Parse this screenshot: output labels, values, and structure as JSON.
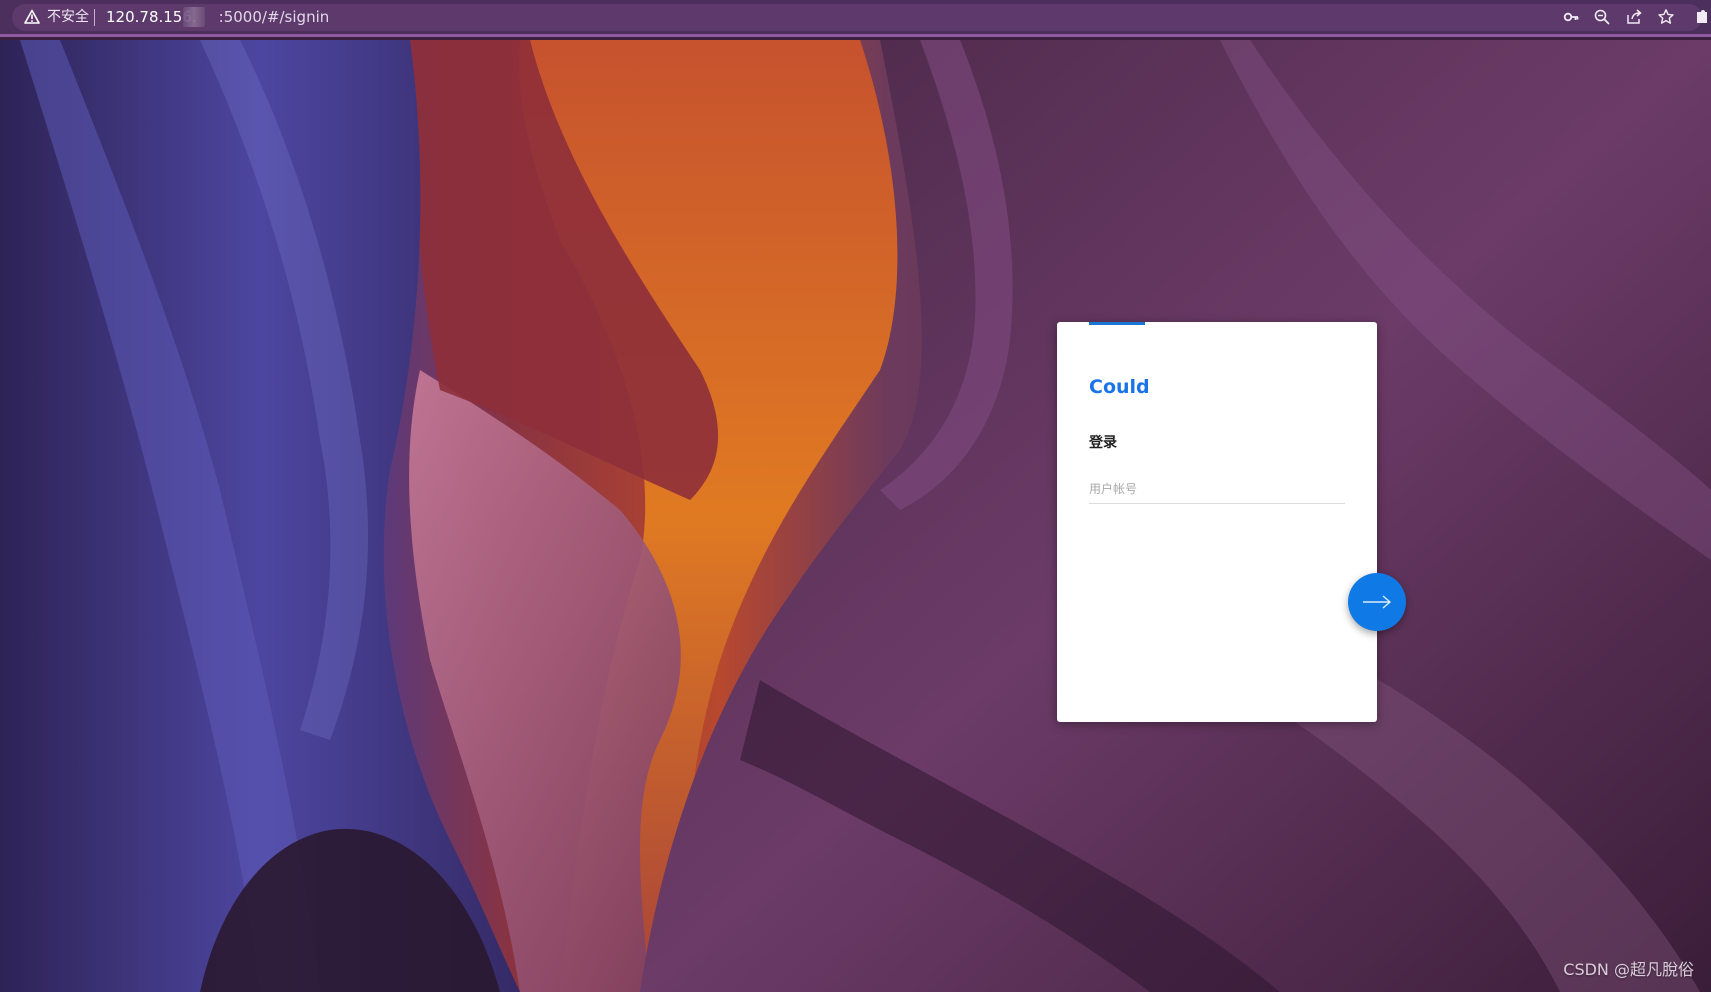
{
  "browser": {
    "security_label": "不安全",
    "url_host": "120.78.156.",
    "url_rest": ":5000/#/signin",
    "icons": [
      "warning-icon",
      "key-icon",
      "zoom-icon",
      "share-icon",
      "star-icon",
      "extensions-icon"
    ]
  },
  "login": {
    "brand": "Could",
    "heading": "登录",
    "username_placeholder": "用户帐号",
    "username_value": "",
    "next_icon": "arrow-right-icon"
  },
  "colors": {
    "accent": "#1976d2",
    "button": "#0f7ae5",
    "browser_bar": "#4d2f5d"
  },
  "watermark": "CSDN @超凡脫俗"
}
